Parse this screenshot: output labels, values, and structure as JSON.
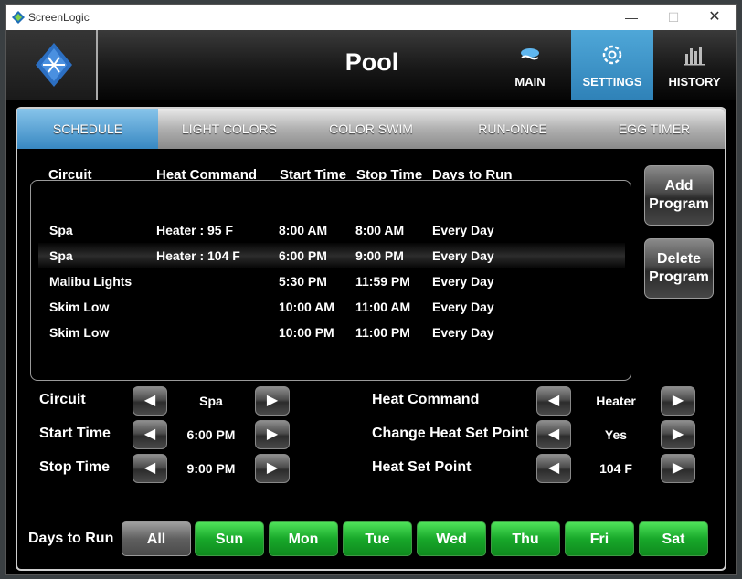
{
  "window": {
    "title": "ScreenLogic",
    "minimize_icon": "—",
    "maximize_icon": "☐",
    "close_icon": "✕"
  },
  "header": {
    "title": "Pool",
    "nav": [
      {
        "label": "MAIN",
        "icon": "pool-icon",
        "active": false
      },
      {
        "label": "SETTINGS",
        "icon": "gear-icon",
        "active": true
      },
      {
        "label": "HISTORY",
        "icon": "bar-chart-icon",
        "active": false
      }
    ]
  },
  "tabs": [
    "SCHEDULE",
    "LIGHT COLORS",
    "COLOR SWIM",
    "RUN-ONCE",
    "EGG TIMER"
  ],
  "active_tab": "SCHEDULE",
  "schedule": {
    "columns": [
      "Circuit",
      "Heat Command",
      "Start Time",
      "Stop Time",
      "Days to Run"
    ],
    "rows": [
      {
        "circuit": "Spa",
        "heat": "Heater : 95 F",
        "start": "8:00  AM",
        "stop": "8:00  AM",
        "days": "Every Day",
        "selected": false
      },
      {
        "circuit": "Spa",
        "heat": "Heater : 104 F",
        "start": "6:00  PM",
        "stop": "9:00  PM",
        "days": "Every Day",
        "selected": true
      },
      {
        "circuit": "Malibu Lights",
        "heat": "",
        "start": "5:30  PM",
        "stop": "11:59  PM",
        "days": "Every Day",
        "selected": false
      },
      {
        "circuit": "Skim Low",
        "heat": "",
        "start": "10:00  AM",
        "stop": "11:00  AM",
        "days": "Every Day",
        "selected": false
      },
      {
        "circuit": "Skim Low",
        "heat": "",
        "start": "10:00  PM",
        "stop": "11:00  PM",
        "days": "Every Day",
        "selected": false
      }
    ]
  },
  "buttons": {
    "add": "Add Program",
    "delete": "Delete Program"
  },
  "fields": {
    "circuit": {
      "label": "Circuit",
      "value": "Spa"
    },
    "start_time": {
      "label": "Start Time",
      "value": "6:00  PM"
    },
    "stop_time": {
      "label": "Stop Time",
      "value": "9:00  PM"
    },
    "heat_command": {
      "label": "Heat Command",
      "value": "Heater"
    },
    "change_heat": {
      "label": "Change Heat Set Point",
      "value": "Yes"
    },
    "heat_set_point": {
      "label": "Heat Set Point",
      "value": "104 F"
    }
  },
  "arrows": {
    "left": "◀",
    "right": "▶"
  },
  "days_to_run": {
    "label": "Days to Run",
    "days": [
      {
        "label": "All",
        "selected": false
      },
      {
        "label": "Sun",
        "selected": true
      },
      {
        "label": "Mon",
        "selected": true
      },
      {
        "label": "Tue",
        "selected": true
      },
      {
        "label": "Wed",
        "selected": true
      },
      {
        "label": "Thu",
        "selected": true
      },
      {
        "label": "Fri",
        "selected": true
      },
      {
        "label": "Sat",
        "selected": true
      }
    ]
  },
  "colors": {
    "accent_blue": "#3888c2",
    "day_green": "#18a82a",
    "background": "#000000"
  }
}
